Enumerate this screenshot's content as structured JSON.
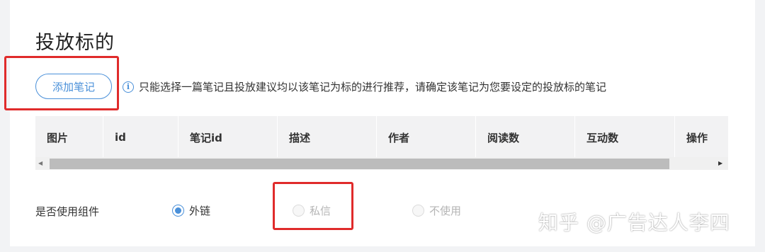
{
  "section": {
    "title": "投放标的"
  },
  "add_button": {
    "label": "添加笔记"
  },
  "info": {
    "icon": "info-circle-icon",
    "text": "只能选择一篇笔记且投放建议均以该笔记为标的进行推荐，请确定该笔记为您要设定的投放标的笔记"
  },
  "table": {
    "columns": [
      "图片",
      "id",
      "笔记id",
      "描述",
      "作者",
      "阅读数",
      "互动数",
      "操作"
    ]
  },
  "component": {
    "label": "是否使用组件",
    "options": [
      {
        "label": "外链",
        "selected": true,
        "disabled": false
      },
      {
        "label": "私信",
        "selected": false,
        "disabled": true
      },
      {
        "label": "不使用",
        "selected": false,
        "disabled": true
      }
    ]
  },
  "watermark": {
    "text": "知乎 @广告达人李四"
  },
  "colors": {
    "accent": "#4a90d9",
    "highlight_box": "#e02b2b",
    "header_bg": "#f2f2f3"
  }
}
